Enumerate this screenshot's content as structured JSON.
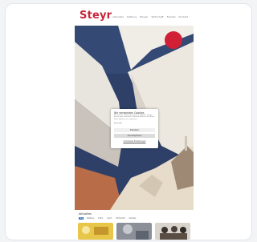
{
  "site": {
    "logo": "Steyr",
    "nav": [
      "Aktuelles",
      "Rathaus",
      "Bürger",
      "Wirtschaft",
      "Freizeit",
      "Kontakt"
    ]
  },
  "cookie_dialog": {
    "title": "Wir verwenden Cookies",
    "text": "Wir nutzen Cookies auf unserer Website. Einige davon sind essenziell, während andere uns helfen, diese Website zu verbessern.",
    "checkbox_label": "Essenziell",
    "settings_label": "Statistiken",
    "save_label": "Speichern",
    "accept_all_label": "Alle akzeptieren",
    "decline_label": "Individuelle Einstellungen"
  },
  "section": {
    "heading": "Aktuelles",
    "tabs": [
      "Alle",
      "Rathaus",
      "Kultur",
      "Sport",
      "Wirtschaft",
      "Soziales"
    ]
  },
  "colors": {
    "brand": "#c8243a",
    "sky": "#2e3f68",
    "badge": "#d11f36",
    "tab_active": "#2f6fb3"
  }
}
